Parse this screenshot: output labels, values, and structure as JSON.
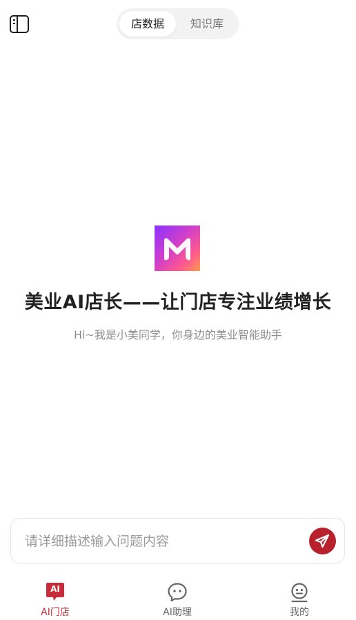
{
  "header": {
    "tabs": [
      {
        "label": "店数据",
        "active": true
      },
      {
        "label": "知识库",
        "active": false
      }
    ],
    "sidebar_icon": "sidebar-panel-icon"
  },
  "hero": {
    "logo_icon": "meiye-m-logo",
    "title": "美业AI店长——让门店专注业绩增长",
    "subtitle": "Hi~我是小美同学，你身边的美业智能助手"
  },
  "composer": {
    "placeholder": "请详细描述输入问题内容",
    "value": "",
    "send_icon": "paper-plane-icon"
  },
  "bottom_nav": {
    "items": [
      {
        "label": "AI门店",
        "icon": "ai-badge-icon",
        "active": true
      },
      {
        "label": "AI助理",
        "icon": "chat-bubble-icon",
        "active": false
      },
      {
        "label": "我的",
        "icon": "profile-face-icon",
        "active": false
      }
    ],
    "ai_badge_text": "AI"
  },
  "colors": {
    "accent": "#c62c3a",
    "send_button": "#b8202b",
    "muted_text": "#8e8e8e"
  }
}
